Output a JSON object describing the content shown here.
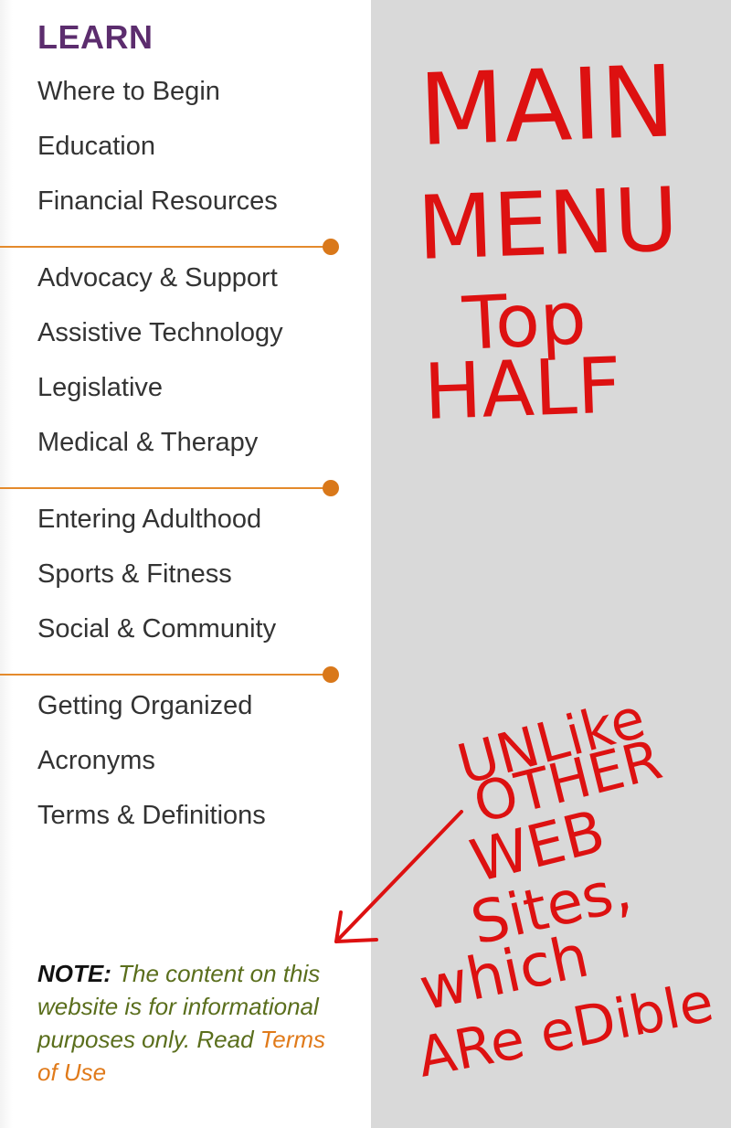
{
  "sidebar": {
    "title": "LEARN",
    "groups": [
      {
        "items": [
          {
            "label": "Where to Begin"
          },
          {
            "label": "Education"
          },
          {
            "label": "Financial Resources"
          }
        ]
      },
      {
        "items": [
          {
            "label": "Advocacy & Support"
          },
          {
            "label": "Assistive Technology"
          },
          {
            "label": "Legislative"
          },
          {
            "label": "Medical & Therapy"
          }
        ]
      },
      {
        "items": [
          {
            "label": "Entering Adulthood"
          },
          {
            "label": "Sports & Fitness"
          },
          {
            "label": "Social & Community"
          }
        ]
      },
      {
        "items": [
          {
            "label": "Getting Organized"
          },
          {
            "label": "Acronyms"
          },
          {
            "label": "Terms & Definitions"
          }
        ]
      }
    ],
    "note": {
      "label": "NOTE:",
      "text": " The content on this website is for informational purposes only. Read ",
      "link": "Terms of Use"
    }
  },
  "annotation": {
    "lines": [
      "MAIN",
      "MENU",
      "Top",
      "HALF",
      "UNLike",
      "OTHER",
      "WEB",
      "Sites,",
      "which",
      "ARe eDible"
    ],
    "color": "#dd1111"
  },
  "colors": {
    "title": "#5c2d6e",
    "menu_text": "#333333",
    "divider": "#e48a2c",
    "note_text": "#5a6e1c",
    "note_link": "#e07a1a",
    "background": "#d9d9d9"
  }
}
